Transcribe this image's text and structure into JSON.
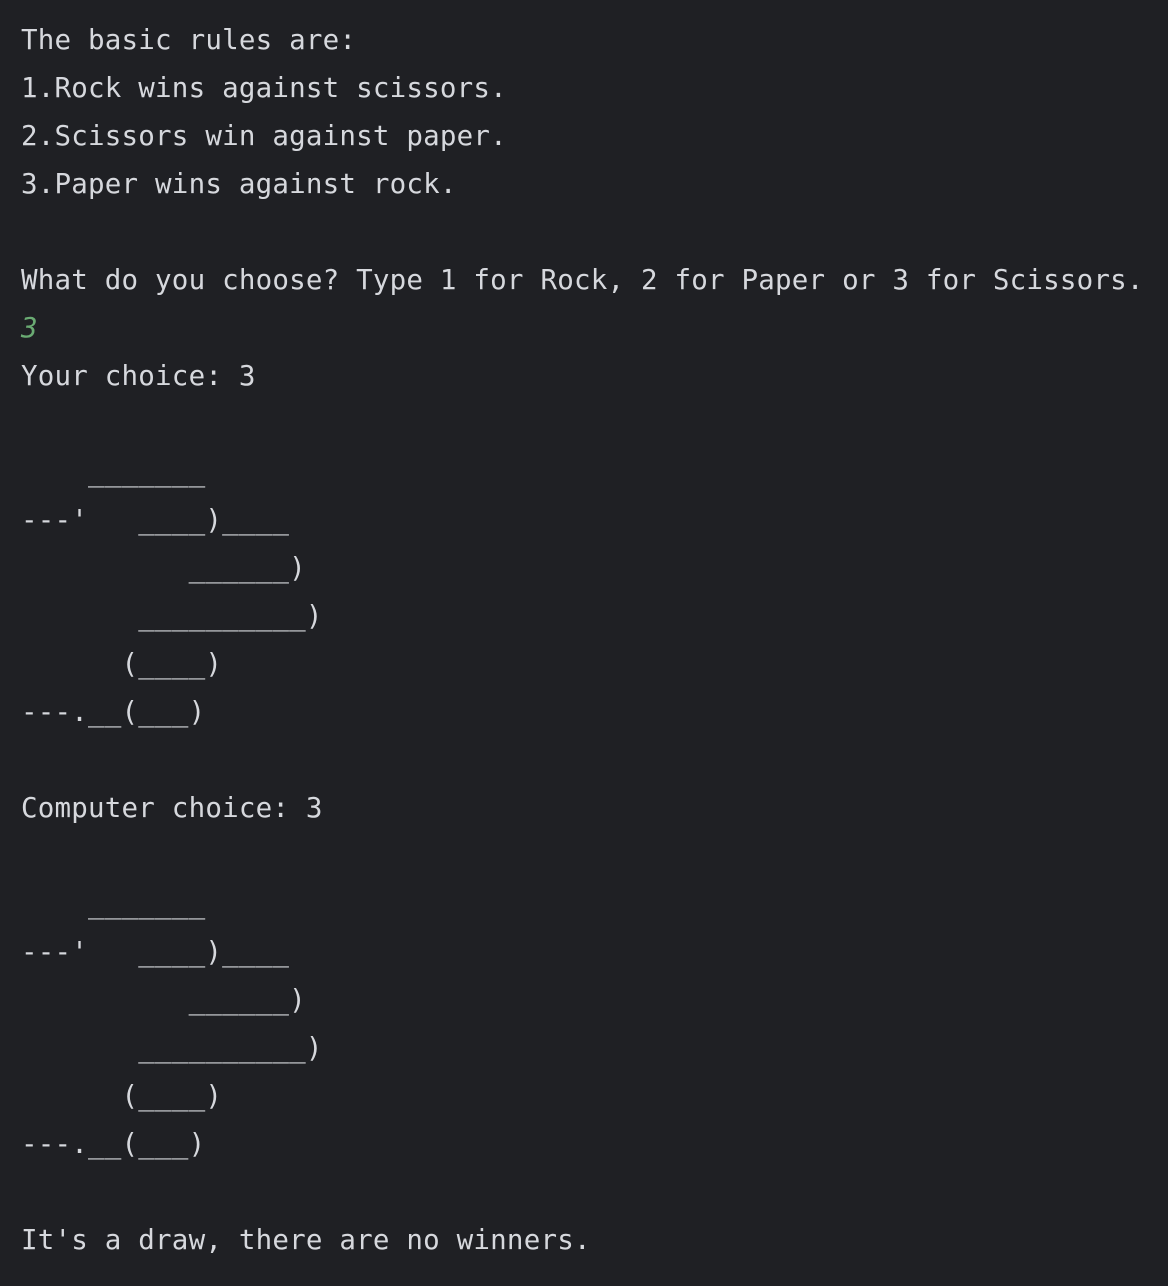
{
  "console": {
    "lines": [
      {
        "kind": "out",
        "text": "The basic rules are:"
      },
      {
        "kind": "out",
        "text": "1.Rock wins against scissors."
      },
      {
        "kind": "out",
        "text": "2.Scissors win against paper."
      },
      {
        "kind": "out",
        "text": "3.Paper wins against rock."
      },
      {
        "kind": "out",
        "text": ""
      },
      {
        "kind": "out",
        "text": "What do you choose? Type 1 for Rock, 2 for Paper or 3 for Scissors."
      },
      {
        "kind": "input",
        "text": "3"
      },
      {
        "kind": "out",
        "text": "Your choice: 3"
      },
      {
        "kind": "out",
        "text": ""
      },
      {
        "kind": "out",
        "text": "    _______"
      },
      {
        "kind": "out",
        "text": "---'   ____)____"
      },
      {
        "kind": "out",
        "text": "          ______)"
      },
      {
        "kind": "out",
        "text": "       __________)"
      },
      {
        "kind": "out",
        "text": "      (____)"
      },
      {
        "kind": "out",
        "text": "---.__(___)"
      },
      {
        "kind": "out",
        "text": ""
      },
      {
        "kind": "out",
        "text": "Computer choice: 3"
      },
      {
        "kind": "out",
        "text": ""
      },
      {
        "kind": "out",
        "text": "    _______"
      },
      {
        "kind": "out",
        "text": "---'   ____)____"
      },
      {
        "kind": "out",
        "text": "          ______)"
      },
      {
        "kind": "out",
        "text": "       __________)"
      },
      {
        "kind": "out",
        "text": "      (____)"
      },
      {
        "kind": "out",
        "text": "---.__(___)"
      },
      {
        "kind": "out",
        "text": ""
      },
      {
        "kind": "out",
        "text": "It's a draw, there are no winners."
      }
    ]
  },
  "colors": {
    "background": "#1f2024",
    "output_text": "#d6d8dd",
    "user_input": "#6aab73"
  }
}
